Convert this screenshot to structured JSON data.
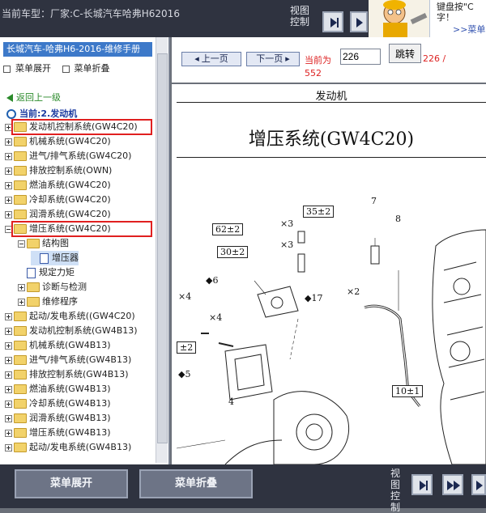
{
  "header": {
    "car_model": "当前车型：厂家:C-长城汽车哈弗H62016",
    "view_control": "视图控制",
    "tip_text_1": "键盘按\"C",
    "tip_text_2": "字！",
    "tip_link": ">>菜单"
  },
  "sidebar": {
    "title": "长城汽车-哈弗H6-2016-维修手册",
    "expand_label": "菜单展开",
    "collapse_label": "菜单折叠",
    "back_label": "返回上一级",
    "current_label": "当前:2.发动机",
    "items": [
      {
        "label": "发动机控制系统(GW4C20)",
        "pm": "plus",
        "icon": "folder",
        "indent": 0,
        "highlight": true
      },
      {
        "label": "机械系统(GW4C20)",
        "pm": "plus",
        "icon": "folder",
        "indent": 0
      },
      {
        "label": "进气/排气系统(GW4C20)",
        "pm": "plus",
        "icon": "folder",
        "indent": 0
      },
      {
        "label": "排放控制系统(OWN)",
        "pm": "plus",
        "icon": "folder",
        "indent": 0
      },
      {
        "label": "燃油系统(GW4C20)",
        "pm": "plus",
        "icon": "folder",
        "indent": 0
      },
      {
        "label": "冷却系统(GW4C20)",
        "pm": "plus",
        "icon": "folder",
        "indent": 0
      },
      {
        "label": "润滑系统(GW4C20)",
        "pm": "plus",
        "icon": "folder",
        "indent": 0
      },
      {
        "label": "增压系统(GW4C20)",
        "pm": "minus",
        "icon": "folder",
        "indent": 0,
        "highlight": true
      },
      {
        "label": "结构图",
        "pm": "minus",
        "icon": "folder",
        "indent": 1
      },
      {
        "label": "增压器",
        "pm": "none",
        "icon": "doc",
        "indent": 2,
        "selected": true
      },
      {
        "label": "规定力矩",
        "pm": "none",
        "icon": "doc",
        "indent": 1
      },
      {
        "label": "诊断与检测",
        "pm": "plus",
        "icon": "folder",
        "indent": 1
      },
      {
        "label": "维修程序",
        "pm": "plus",
        "icon": "folder",
        "indent": 1
      },
      {
        "label": "起动/发电系统((GW4C20)",
        "pm": "plus",
        "icon": "folder",
        "indent": 0
      },
      {
        "label": "发动机控制系统(GW4B13)",
        "pm": "plus",
        "icon": "folder",
        "indent": 0
      },
      {
        "label": "机械系统(GW4B13)",
        "pm": "plus",
        "icon": "folder",
        "indent": 0
      },
      {
        "label": "进气/排气系统(GW4B13)",
        "pm": "plus",
        "icon": "folder",
        "indent": 0
      },
      {
        "label": "排放控制系统(GW4B13)",
        "pm": "plus",
        "icon": "folder",
        "indent": 0
      },
      {
        "label": "燃油系统(GW4B13)",
        "pm": "plus",
        "icon": "folder",
        "indent": 0
      },
      {
        "label": "冷却系统(GW4B13)",
        "pm": "plus",
        "icon": "folder",
        "indent": 0
      },
      {
        "label": "润滑系统(GW4B13)",
        "pm": "plus",
        "icon": "folder",
        "indent": 0
      },
      {
        "label": "增压系统(GW4B13)",
        "pm": "plus",
        "icon": "folder",
        "indent": 0
      },
      {
        "label": "起动/发电系统(GW4B13)",
        "pm": "plus",
        "icon": "folder",
        "indent": 0
      }
    ]
  },
  "pager": {
    "prev_label": "上一页",
    "next_label": "下一页",
    "current_label": "当前为",
    "page_value": "226",
    "jump_label": "跳转",
    "page_count": "226 /",
    "page_total": "552"
  },
  "document": {
    "section": "发动机",
    "system_title": "增压系统(GW4C20)",
    "diagram_labels": {
      "l35": "35±2",
      "l7": "7",
      "l62": "62±2",
      "x3a": "×3",
      "l8": "8",
      "l30": "30±2",
      "x3b": "×3",
      "l6": "◆6",
      "x4a": "×4",
      "x2": "×2",
      "l17": "◆17",
      "x4b": "×4",
      "l2": "±2",
      "l5": "◆5",
      "l4": "4",
      "l10": "10±1"
    }
  },
  "footer": {
    "expand_label": "菜单展开",
    "collapse_label": "菜单折叠",
    "view_control": "视图控制"
  },
  "colors": {
    "accent_blue": "#3d79c9",
    "highlight_red": "#e02020",
    "page_red": "#d22222"
  }
}
